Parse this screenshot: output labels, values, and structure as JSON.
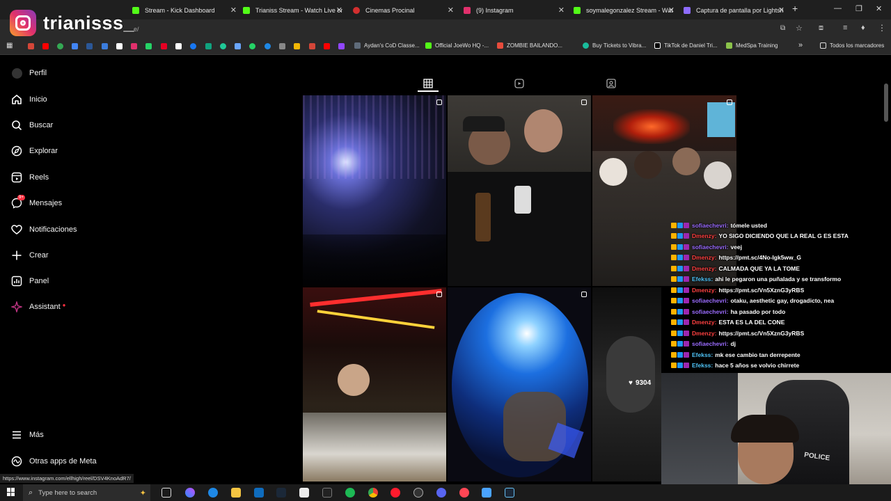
{
  "browser": {
    "tabs": [
      {
        "title": "Stream - Kick Dashboard",
        "icon_color": "#53fc18"
      },
      {
        "title": "Trianiss Stream - Watch Live on",
        "icon_color": "#53fc18"
      },
      {
        "title": "Cinemas Procinal",
        "icon_color": "#d32f2f"
      },
      {
        "title": "(9) Instagram",
        "icon_color": "#e1306c"
      },
      {
        "title": "soymalegonzalez Stream - Wat",
        "icon_color": "#53fc18"
      },
      {
        "title": "Captura de pantalla por Lightsh",
        "icon_color": "#8e6cff"
      }
    ],
    "address_url_fragment": "e/",
    "bookmarks": [
      "Aydan's CoD Classe...",
      "Official JoeWo HQ -...",
      "ZOMBIE BAILANDO...",
      "Buy Tickets to Vibra...",
      "TikTok de Daniel Tri...",
      "MedSpa Training"
    ],
    "bookmarks_folder": "Todos los marcadores",
    "status_url": "https://www.instagram.com/ellhigh/reel/DSV4KnoAdR7/"
  },
  "overlay": {
    "username": "trianisss_"
  },
  "sidebar": {
    "items": [
      {
        "label": "Perfil",
        "icon": "avatar-icon"
      },
      {
        "label": "Inicio",
        "icon": "home-icon"
      },
      {
        "label": "Buscar",
        "icon": "search-icon"
      },
      {
        "label": "Explorar",
        "icon": "compass-icon"
      },
      {
        "label": "Reels",
        "icon": "reels-icon"
      },
      {
        "label": "Mensajes",
        "icon": "messenger-icon",
        "badge": "9+"
      },
      {
        "label": "Notificaciones",
        "icon": "heart-icon"
      },
      {
        "label": "Crear",
        "icon": "plus-icon"
      },
      {
        "label": "Panel",
        "icon": "dashboard-icon"
      },
      {
        "label": "Assistant",
        "icon": "sparkle-icon"
      }
    ],
    "bottom_items": [
      {
        "label": "Más",
        "icon": "menu-icon"
      },
      {
        "label": "Otras apps de Meta",
        "icon": "meta-icon"
      }
    ]
  },
  "profile_tabs": [
    "grid-icon",
    "reels-tab-icon",
    "tagged-icon"
  ],
  "grid": {
    "likes_overlay": "9304"
  },
  "chat": {
    "lines": [
      {
        "user": "sofiaechevri:",
        "user_color": "#9b6cff",
        "msg": "tómele usted"
      },
      {
        "user": "Dmenzy:",
        "user_color": "#ff4040",
        "msg": "YO SIGO DICIENDO QUE LA REAL G ES ESTA"
      },
      {
        "user": "sofiaechevri:",
        "user_color": "#9b6cff",
        "msg": "veej"
      },
      {
        "user": "Dmenzy:",
        "user_color": "#ff4040",
        "msg": "https://pmt.sc/4No-Igk5ww_G"
      },
      {
        "user": "Dmenzy:",
        "user_color": "#ff4040",
        "msg": "CALMADA QUE YA LA TOME"
      },
      {
        "user": "Efekss:",
        "user_color": "#4fc3f7",
        "msg": "ahi le pegaron una puñalada y se transformo"
      },
      {
        "user": "Dmenzy:",
        "user_color": "#ff4040",
        "msg": "https://pmt.sc/Vn5XznG3yRBS"
      },
      {
        "user": "sofiaechevri:",
        "user_color": "#9b6cff",
        "msg": "otaku, aesthetic gay, drogadicto, nea"
      },
      {
        "user": "sofiaechevri:",
        "user_color": "#9b6cff",
        "msg": "ha pasado por todo"
      },
      {
        "user": "Dmenzy:",
        "user_color": "#ff4040",
        "msg": "ESTA ES LA DEL CONE"
      },
      {
        "user": "Dmenzy:",
        "user_color": "#ff4040",
        "msg": "https://pmt.sc/Vn5XznG3yRBS"
      },
      {
        "user": "sofiaechevri:",
        "user_color": "#9b6cff",
        "msg": "dj"
      },
      {
        "user": "Efekss:",
        "user_color": "#4fc3f7",
        "msg": "mk ese cambio tan derrepente"
      },
      {
        "user": "Efekss:",
        "user_color": "#4fc3f7",
        "msg": "hace 5 años se volvio chirrete"
      }
    ]
  },
  "taskbar": {
    "search_placeholder": "Type here to search"
  }
}
